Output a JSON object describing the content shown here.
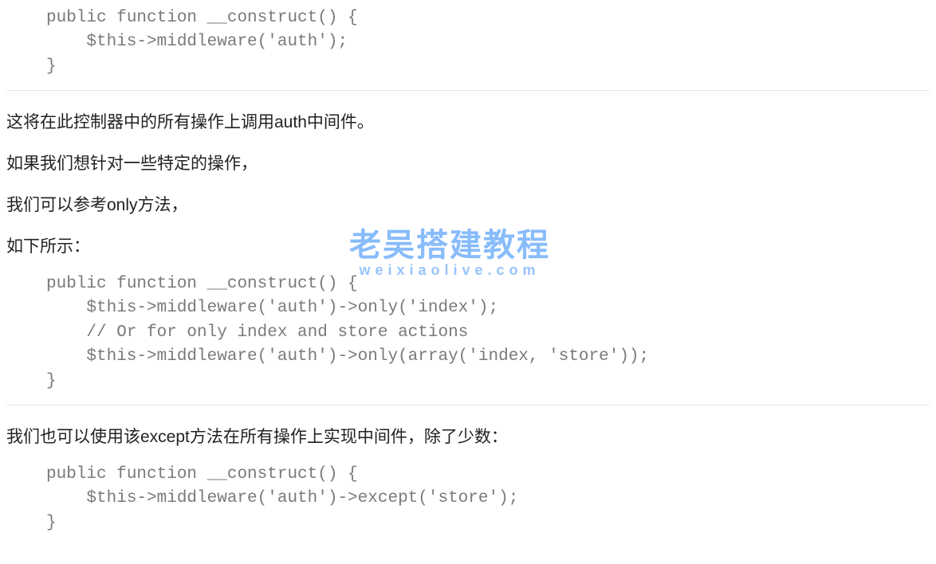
{
  "code1": {
    "l0": "public function __construct() {",
    "l1": "    $this->middleware('auth');",
    "l2": "}"
  },
  "p1": "这将在此控制器中的所有操作上调用auth中间件。",
  "p2": "如果我们想针对一些特定的操作，",
  "p3": "我们可以参考only方法，",
  "p4": "如下所示：",
  "code2": {
    "l0": "public function __construct() {",
    "l1": "    $this->middleware('auth')->only('index');",
    "l2": "",
    "l3": "    // Or for only index and store actions",
    "l4": "    $this->middleware('auth')->only(array('index, 'store'));",
    "l5": "}"
  },
  "p5": "我们也可以使用该except方法在所有操作上实现中间件，除了少数：",
  "code3": {
    "l0": "public function __construct() {",
    "l1": "    $this->middleware('auth')->except('store');",
    "l2": "}"
  },
  "watermark": {
    "zh": "老吴搭建教程",
    "en": "weixiaolive.com"
  }
}
